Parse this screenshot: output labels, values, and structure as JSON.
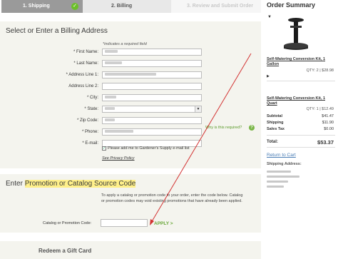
{
  "steps": [
    {
      "label": "1. Shipping"
    },
    {
      "label": "2. Billing"
    },
    {
      "label": "3. Review and Submit Order"
    }
  ],
  "billing": {
    "title": "Select or Enter a Billing Address",
    "required_note": "*indicates a required field",
    "fields": [
      {
        "label": "* First Name:"
      },
      {
        "label": "* Last Name:"
      },
      {
        "label": "* Address Line 1:"
      },
      {
        "label": "Address Line 2:"
      },
      {
        "label": "* City:"
      },
      {
        "label": "* State:"
      },
      {
        "label": "* Zip Code:"
      },
      {
        "label": "* Phone:"
      },
      {
        "label": "* E-mail:"
      }
    ],
    "why_required": "Why is this required?",
    "help_glyph": "?",
    "newsletter_label": "Please add me to Gardener's Supply e-mail list",
    "privacy_link": "See Privacy Policy",
    "newsletter_checked": true
  },
  "promo": {
    "title": "Enter Promotion or Catalog Source Code",
    "description": "To apply a catalog or promotion code to your order, enter the code below. Catalog or promotion codes may void existing promotions that have already been applied.",
    "code_label": "Catalog or Promotion Code:",
    "code_value": "",
    "apply_label": "APPLY >"
  },
  "gift": {
    "title": "Redeem a Gift Card"
  },
  "summary": {
    "title": "Order Summary",
    "items": [
      {
        "name": "Self-Watering Conversion Kit, 1 Gallon",
        "qty": "QTY: 2 | $28.98"
      },
      {
        "name": "Self-Watering Conversion Kit, 1 Quart",
        "qty": "QTY: 1 | $12.49"
      }
    ],
    "totals": [
      {
        "label": "Subtotal",
        "value": "$41.47"
      },
      {
        "label": "Shipping",
        "value": "$11.90"
      },
      {
        "label": "Sales Tax",
        "value": "$0.00"
      }
    ],
    "total_label": "Total:",
    "total_value": "$53.37",
    "return_link": "Return to Cart",
    "shipping_address_label": "Shipping Address:"
  },
  "colors": {
    "accent_green": "#6aa83a",
    "annotation_red": "#d33333",
    "highlight_yellow": "#fff08a"
  }
}
